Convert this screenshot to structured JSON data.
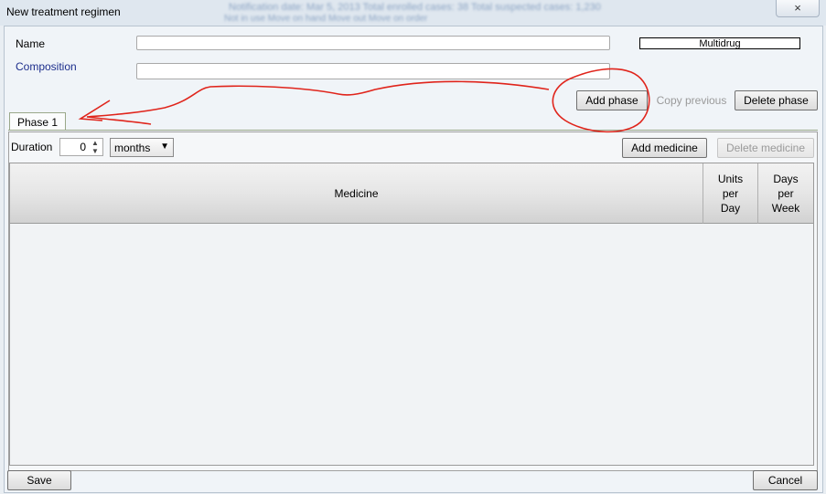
{
  "window": {
    "title": "New treatment regimen",
    "close_label": "×",
    "background_text_1": "Notification date: Mar 5, 2013   Total enrolled cases: 38   Total suspected cases: 1,230",
    "background_text_2": "Not in use   Move on hand   Move out   Move on order"
  },
  "form": {
    "name_label": "Name",
    "name_value": "",
    "composition_label": "Composition",
    "composition_value": "",
    "multidrug_label": "Multidrug"
  },
  "phase_toolbar": {
    "add_phase": "Add phase",
    "copy_previous": "Copy previous",
    "delete_phase": "Delete phase"
  },
  "tabs": [
    {
      "label": "Phase 1",
      "selected": true
    }
  ],
  "phase": {
    "duration_label": "Duration",
    "duration_value": "0",
    "unit_value": "months",
    "add_medicine": "Add medicine",
    "delete_medicine": "Delete medicine"
  },
  "table": {
    "columns": [
      "Medicine",
      "Units\nper\nDay",
      "Days\nper\nWeek"
    ],
    "rows": []
  },
  "footer": {
    "save": "Save",
    "cancel": "Cancel"
  },
  "colors": {
    "annotation": "#e0241b",
    "tab_border": "#9aa88a"
  }
}
